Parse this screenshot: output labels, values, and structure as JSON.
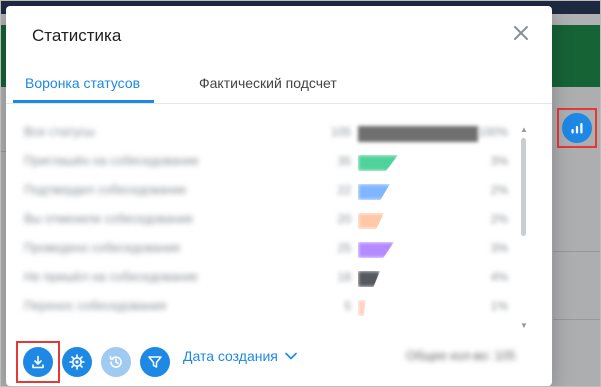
{
  "modal": {
    "title": "Статистика"
  },
  "tabs": [
    {
      "label": "Воронка статусов",
      "active": true
    },
    {
      "label": "Фактический подсчет",
      "active": false
    }
  ],
  "funnel_rows": [
    {
      "label": "Все статусы",
      "count": "105",
      "fill": 1.0,
      "color": "#6f6f6f",
      "percent": "100%"
    },
    {
      "label": "Приглашён на собеседование",
      "count": "35",
      "fill": 0.33,
      "color": "#4fd39a",
      "percent": "3%"
    },
    {
      "label": "Подтвердил собеседование",
      "count": "22",
      "fill": 0.27,
      "color": "#7fb6ff",
      "percent": "2%"
    },
    {
      "label": "Вы отменили собеседование",
      "count": "20",
      "fill": 0.22,
      "color": "#ffc9a8",
      "percent": "2%"
    },
    {
      "label": "Проведено собеседование",
      "count": "25",
      "fill": 0.3,
      "color": "#b58cff",
      "percent": "3%"
    },
    {
      "label": "Не пришёл на собеседование",
      "count": "18",
      "fill": 0.18,
      "color": "#555a60",
      "percent": "4%"
    },
    {
      "label": "Перенос собеседования",
      "count": "5",
      "fill": 0.07,
      "color": "#ffd2c2",
      "percent": "1%"
    }
  ],
  "footer": {
    "date_filter_label": "Дата создания",
    "total_text": "Общее кол-во: 105"
  },
  "icons": {
    "close": "close-icon",
    "export": "download-icon",
    "settings": "gear-icon",
    "history": "history-icon",
    "filter": "filter-icon",
    "chevron": "chevron-down-icon",
    "stats": "bar-chart-icon"
  },
  "colors": {
    "accent": "#1e88e5",
    "highlight": "#e53935"
  }
}
